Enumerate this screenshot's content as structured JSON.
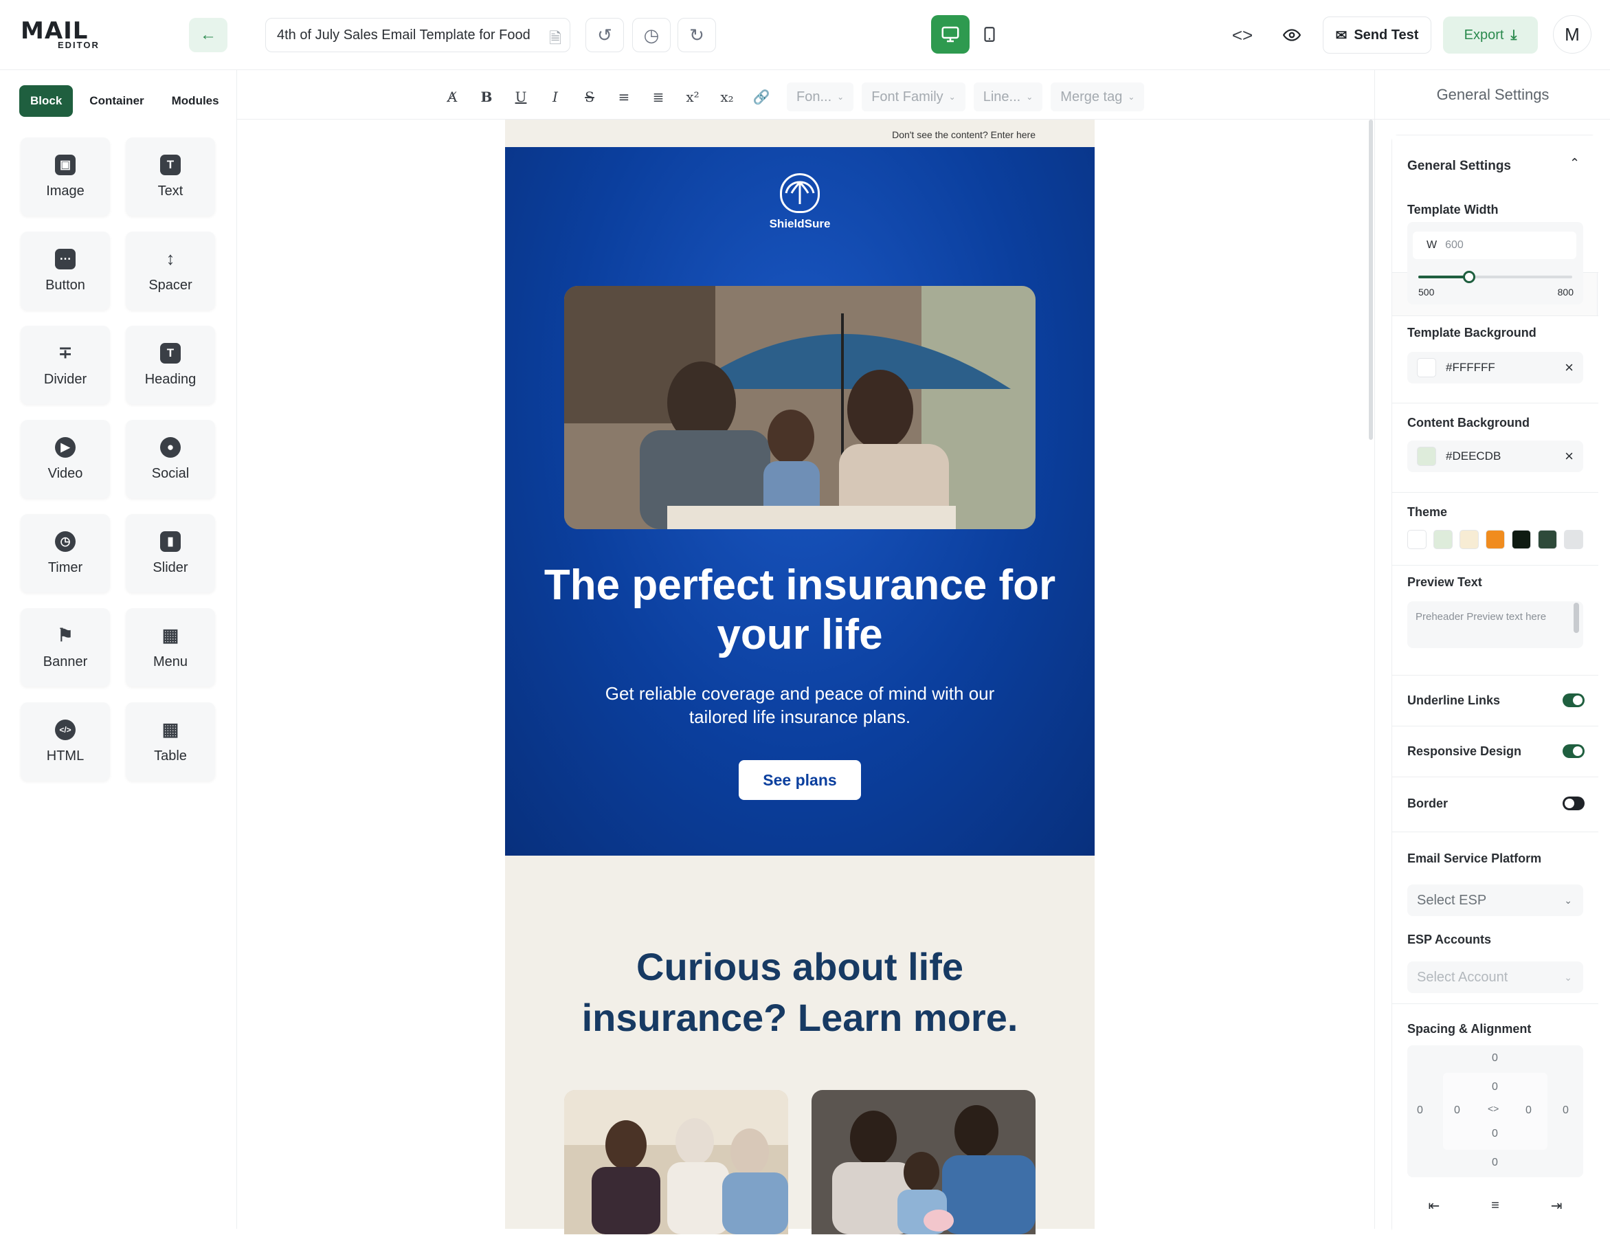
{
  "app": {
    "logo_main": "MAIL",
    "logo_sub": "EDITOR"
  },
  "header": {
    "template_title": "4th of July Sales Email Template for Food",
    "send_test_label": "Send Test",
    "export_label": "Export",
    "avatar_initial": "M"
  },
  "left_panel": {
    "tabs": [
      "Block",
      "Container",
      "Modules"
    ],
    "blocks": [
      "Image",
      "Text",
      "Button",
      "Spacer",
      "Divider",
      "Heading",
      "Video",
      "Social",
      "Timer",
      "Slider",
      "Banner",
      "Menu",
      "HTML",
      "Table"
    ]
  },
  "toolbar": {
    "font_size_placeholder": "Fon...",
    "font_family_placeholder": "Font Family",
    "line_height_placeholder": "Line...",
    "merge_tag_placeholder": "Merge tag"
  },
  "email": {
    "preheader": "Don't see the content? Enter here",
    "brand_name": "ShieldSure",
    "headline": "The perfect insurance for your life",
    "subheadline": "Get reliable coverage and peace of mind with our tailored life insurance plans.",
    "cta_label": "See plans",
    "section_heading": "Curious about life insurance? Learn more."
  },
  "right_panel": {
    "title": "General Settings",
    "section_title": "General Settings",
    "template_width_label": "Template Width",
    "width_prefix": "W",
    "width_value": "600",
    "width_min": "500",
    "width_max": "800",
    "width_slider_fraction": 0.33,
    "template_bg_label": "Template Background",
    "template_bg_value": "#FFFFFF",
    "content_bg_label": "Content Background",
    "content_bg_value": "#DEECDB",
    "theme_label": "Theme",
    "theme_colors": [
      "#ffffff",
      "#deecdb",
      "#f7ecd4",
      "#f08c1e",
      "#0f1b12",
      "#2e4a3a",
      "#e2e4e6"
    ],
    "preview_text_label": "Preview Text",
    "preview_text_placeholder": "Preheader Preview text here",
    "underline_links_label": "Underline Links",
    "underline_links_on": true,
    "responsive_design_label": "Responsive Design",
    "responsive_design_on": true,
    "border_label": "Border",
    "border_on": false,
    "esp_label": "Email Service Platform",
    "esp_placeholder": "Select ESP",
    "esp_accounts_label": "ESP Accounts",
    "esp_accounts_placeholder": "Select Account",
    "spacing_label": "Spacing & Alignment",
    "spacing_values": {
      "outer_top": "0",
      "inner_top": "0",
      "outer_left": "0",
      "inner_left": "0",
      "inner_right": "0",
      "outer_right": "0",
      "inner_bottom": "0",
      "outer_bottom": "0"
    }
  },
  "colors": {
    "accent": "#1f5f3f",
    "hero_blue": "#0b3f9e",
    "heading_navy": "#173a63",
    "content_bg": "#f2efe8"
  }
}
